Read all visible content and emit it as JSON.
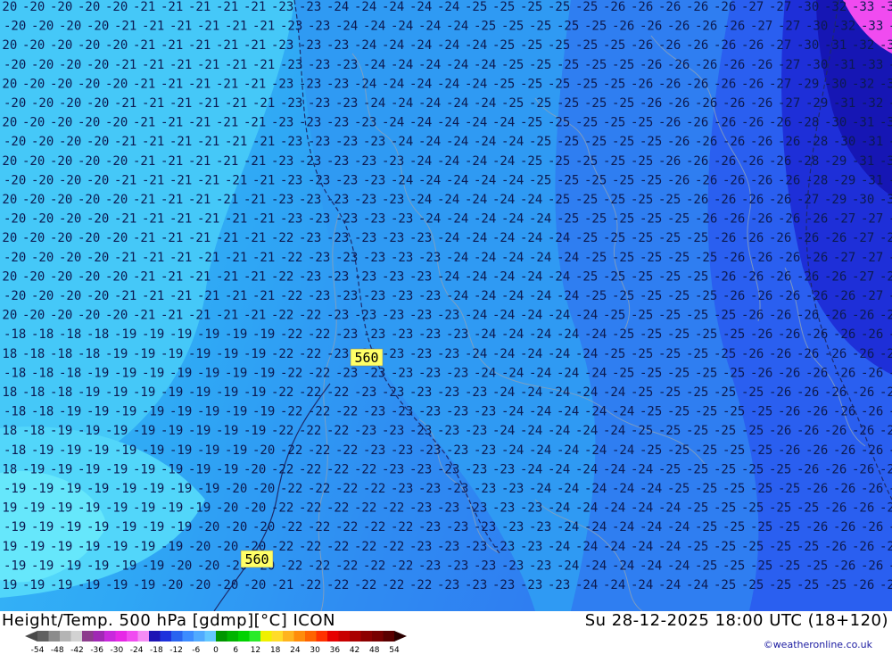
{
  "map": {
    "height_labels": [
      "560",
      "560"
    ]
  },
  "footer": {
    "title_left": "Height/Temp. 500 hPa [gdmp][°C] ICON",
    "title_right": "Su 28-12-2025 18:00 UTC (18+120)",
    "credit": "©weatheronline.co.uk"
  },
  "legend": {
    "ticks": [
      "-54",
      "-48",
      "-42",
      "-36",
      "-30",
      "-24",
      "-18",
      "-12",
      "-6",
      "0",
      "6",
      "12",
      "18",
      "24",
      "30",
      "36",
      "42",
      "48",
      "54"
    ],
    "colors": [
      "#606060",
      "#8c8c8c",
      "#b4b4b4",
      "#d2d2d2",
      "#8c3c8c",
      "#a028b4",
      "#c828dc",
      "#e628e6",
      "#f04bf0",
      "#f58cf5",
      "#1e14b4",
      "#1e32dc",
      "#2864f0",
      "#3c8cff",
      "#50aaff",
      "#64c8ff",
      "#009600",
      "#00b400",
      "#00d200",
      "#28eb28",
      "#f0f000",
      "#ffdc28",
      "#ffb41e",
      "#ff8c0a",
      "#ff6400",
      "#ff3200",
      "#e60000",
      "#c80000",
      "#aa0000",
      "#8c0000",
      "#780000",
      "#5a0000"
    ]
  }
}
